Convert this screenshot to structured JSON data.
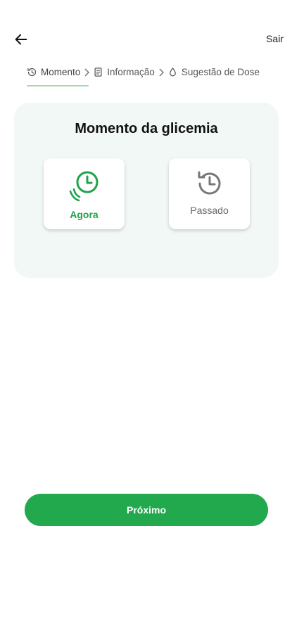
{
  "header": {
    "back_icon": "arrow-left-icon",
    "exit_label": "Sair"
  },
  "stepper": {
    "steps": [
      {
        "label": "Momento",
        "icon": "history-clock-icon",
        "active": true
      },
      {
        "label": "Informação",
        "icon": "document-icon",
        "active": false
      },
      {
        "label": "Sugestão de Dose",
        "icon": "drop-icon",
        "active": false
      }
    ]
  },
  "card": {
    "title": "Momento da glicemia",
    "options": [
      {
        "label": "Agora",
        "icon": "clock-now-icon",
        "selected": true
      },
      {
        "label": "Passado",
        "icon": "history-icon",
        "selected": false
      }
    ]
  },
  "footer": {
    "next_label": "Próximo"
  },
  "colors": {
    "accent": "#22a84d",
    "card_bg": "#f1f8f6",
    "step_underline": "#a8d8b2"
  }
}
